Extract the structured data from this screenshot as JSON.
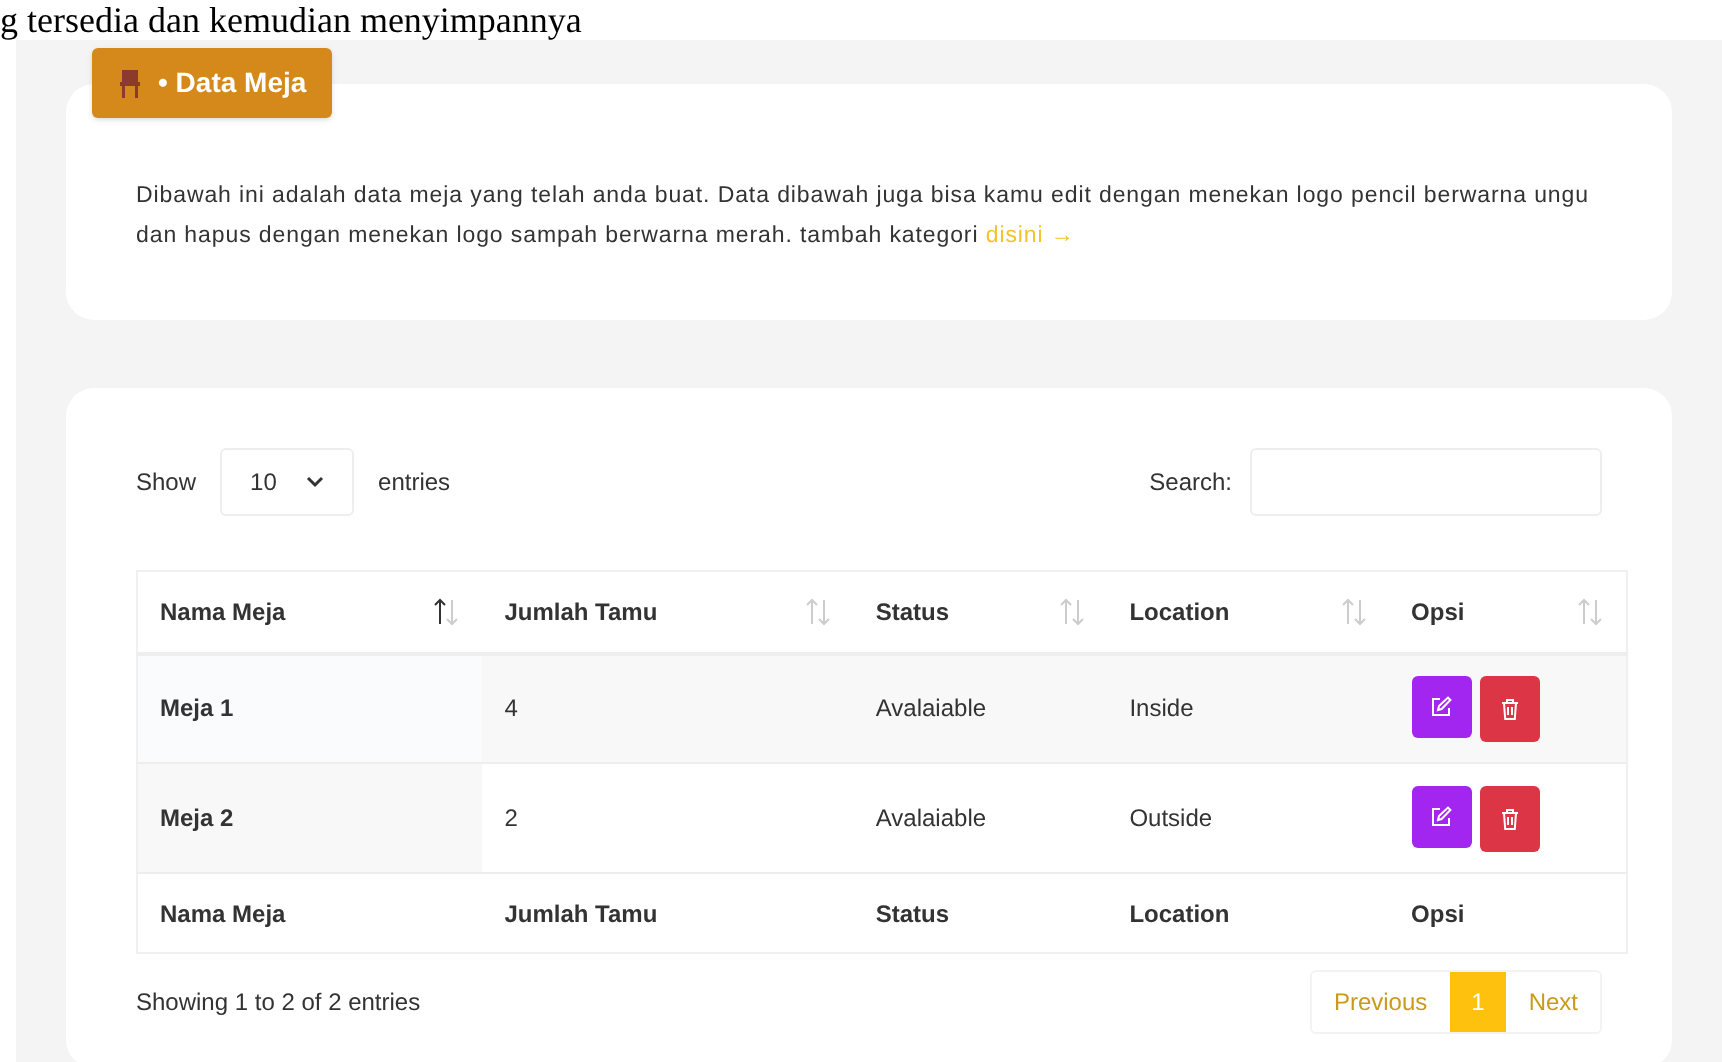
{
  "top_text": "g tersedia dan kemudian menyimpannya",
  "badge": {
    "label": "• Data Meja"
  },
  "description": {
    "text": "Dibawah ini adalah data meja yang telah anda buat. Data dibawah juga bisa kamu edit dengan menekan logo pencil berwarna ungu dan hapus dengan menekan logo sampah berwarna merah. tambah kategori",
    "link": "disini →"
  },
  "length": {
    "show": "Show",
    "value": "10",
    "entries": "entries"
  },
  "search": {
    "label": "Search:"
  },
  "table": {
    "columns": [
      {
        "label": "Nama Meja",
        "sorted": true
      },
      {
        "label": "Jumlah Tamu",
        "sorted": false
      },
      {
        "label": "Status",
        "sorted": false
      },
      {
        "label": "Location",
        "sorted": false
      },
      {
        "label": "Opsi",
        "sorted": false
      }
    ],
    "rows": [
      {
        "cells": [
          "Meja 1",
          "4",
          "Avalaiable",
          "Inside"
        ]
      },
      {
        "cells": [
          "Meja 2",
          "2",
          "Avalaiable",
          "Outside"
        ]
      }
    ],
    "footer": [
      "Nama Meja",
      "Jumlah Tamu",
      "Status",
      "Location",
      "Opsi"
    ]
  },
  "info": "Showing 1 to 2 of 2 entries",
  "pagination": [
    {
      "label": "Previous",
      "kind": "nav",
      "disabled": true
    },
    {
      "label": "1",
      "kind": "page",
      "selected": true
    },
    {
      "label": "Next",
      "kind": "nav",
      "disabled": true
    }
  ]
}
